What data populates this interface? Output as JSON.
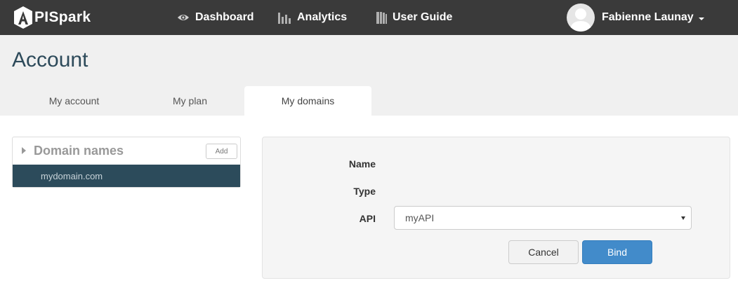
{
  "app": {
    "brand_prefix": "A",
    "brand_name": "PISpark"
  },
  "nav": {
    "dashboard": {
      "label": "Dashboard",
      "icon": "eye-icon"
    },
    "analytics": {
      "label": "Analytics",
      "icon": "bar-chart-icon"
    },
    "user_guide": {
      "label": "User Guide",
      "icon": "book-icon"
    }
  },
  "user": {
    "name": "Fabienne Launay",
    "avatar": "avatar-placeholder-icon"
  },
  "page": {
    "title": "Account"
  },
  "tabs": [
    {
      "label": "My account",
      "active": false
    },
    {
      "label": "My plan",
      "active": false
    },
    {
      "label": "My domains",
      "active": true
    }
  ],
  "domains_panel": {
    "title": "Domain names",
    "add_label": "Add",
    "items": [
      {
        "label": "mydomain.com",
        "selected": true
      }
    ]
  },
  "form": {
    "name_label": "Name",
    "type_label": "Type",
    "api_label": "API",
    "api_value": "myAPI",
    "cancel_label": "Cancel",
    "bind_label": "Bind"
  },
  "colors": {
    "topbar": "#3a3a3a",
    "header_bg": "#f0f0f0",
    "title_color": "#2d4a5a",
    "selected_item": "#2c4b5b",
    "primary_button": "#428bca"
  }
}
